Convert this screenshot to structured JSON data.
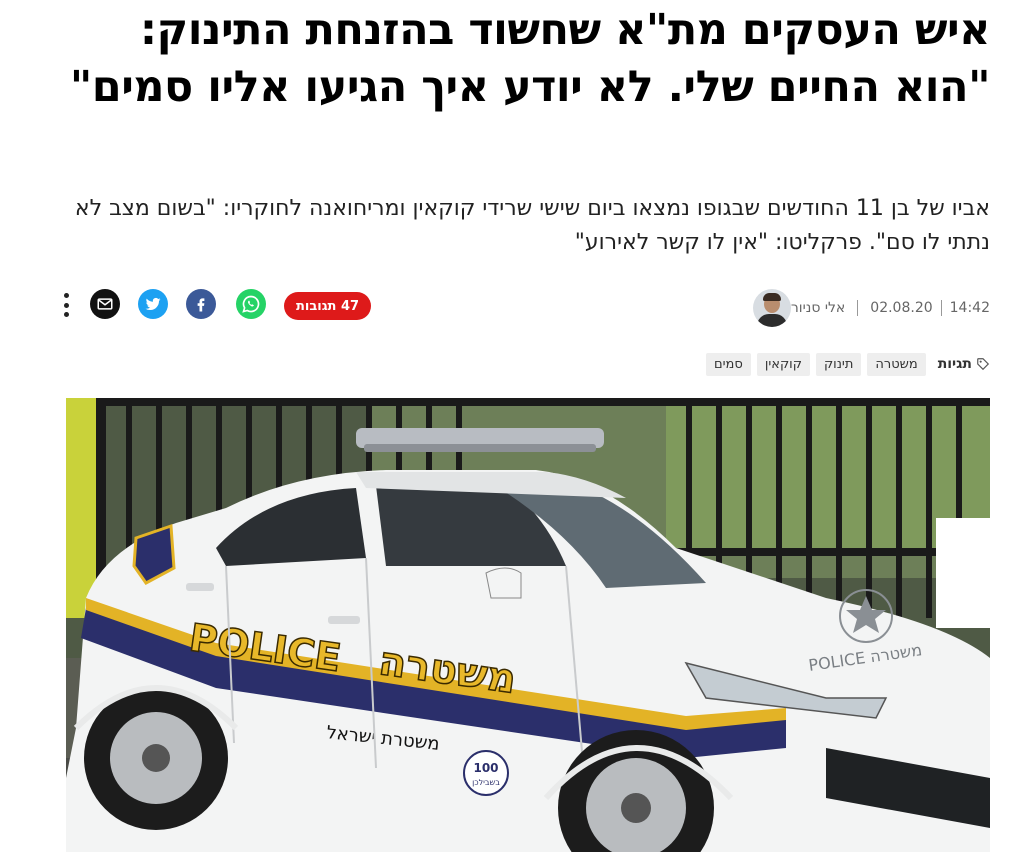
{
  "article": {
    "headline": "איש העסקים מת\"א שחשוד בהזנחת התינוק: \"הוא החיים שלי. לא יודע איך הגיעו אליו סמים\"",
    "subtitle": "אביו של בן 11 החודשים שבגופו נמצאו ביום שישי שרידי קוקאין ומריחואנה לחוקריו: \"בשום מצב לא נתתי לו סם\". פרקליטו: \"אין לו קשר לאירוע\""
  },
  "meta": {
    "author": "אלי סניור",
    "date": "02.08.20",
    "time": "14:42"
  },
  "comments": {
    "label": "47 תגובות"
  },
  "share": {
    "icons": [
      "whatsapp-icon",
      "facebook-icon",
      "twitter-icon",
      "email-icon",
      "more-icon"
    ],
    "colors": {
      "whatsapp": "#25d366",
      "facebook": "#3b5998",
      "twitter": "#1da1f2",
      "email": "#111111",
      "comments": "#de1a1a"
    }
  },
  "tags": {
    "label": "תגיות",
    "items": [
      "משטרה",
      "תינוק",
      "קוקאין",
      "סמים"
    ]
  },
  "hero": {
    "car_text_en": "POLICE",
    "car_text_he": "משטרה",
    "car_text_he_small": "משטרת ישראל",
    "car_hood_text": "POLICE משטרה",
    "car_badge_num": "100",
    "car_badge_text": "בשבילכן"
  }
}
